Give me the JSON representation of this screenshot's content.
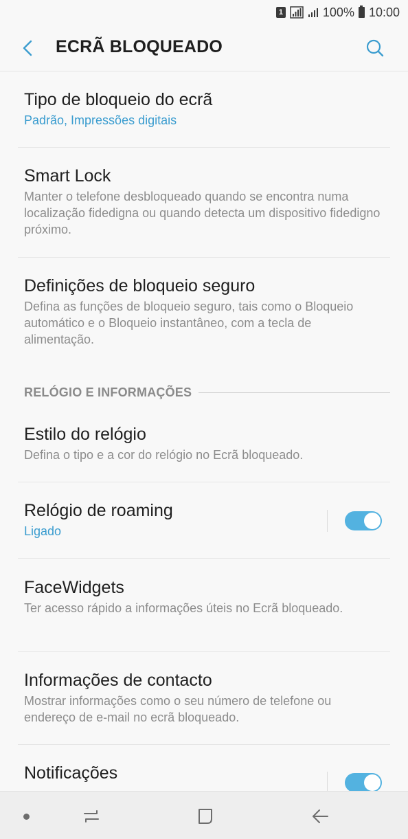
{
  "status_bar": {
    "sim_slot": "1",
    "battery": "100%",
    "time": "10:00"
  },
  "header": {
    "title": "ECRÃ BLOQUEADO",
    "back_icon": "back-arrow-icon",
    "search_icon": "search-icon"
  },
  "settings": {
    "items": [
      {
        "title": "Tipo de bloqueio do ecrã",
        "subtitle": "Padrão, Impressões digitais"
      },
      {
        "title": "Smart Lock",
        "subtitle": "Manter o telefone desbloqueado quando se encontra numa localização fidedigna ou quando detecta um dispositivo fidedigno próximo."
      },
      {
        "title": "Definições de bloqueio seguro",
        "subtitle": "Defina as funções de bloqueio seguro, tais como o Bloqueio automático e o Bloqueio instantâneo, com a tecla de alimentação."
      }
    ],
    "section_header": "RELÓGIO E INFORMAÇÕES",
    "section_items": [
      {
        "title": "Estilo do relógio",
        "subtitle": "Defina o tipo e a cor do relógio no Ecrã bloqueado."
      },
      {
        "title": "Relógio de roaming",
        "subtitle": "Ligado",
        "toggle": true
      },
      {
        "title": "FaceWidgets",
        "subtitle": "Ter acesso rápido a informações úteis no Ecrã bloqueado."
      },
      {
        "title": "Informações de contacto",
        "subtitle": "Mostrar informações como o seu número de telefone ou endereço de e-mail no ecrã bloqueado."
      },
      {
        "title": "Notificações",
        "subtitle": "",
        "toggle": true
      }
    ]
  },
  "colors": {
    "accent": "#3a9ccf",
    "toggle_on": "#53b2e0"
  },
  "nav_bar": {
    "icons": [
      "dot-icon",
      "recent-apps-icon",
      "home-icon",
      "back-icon"
    ]
  }
}
